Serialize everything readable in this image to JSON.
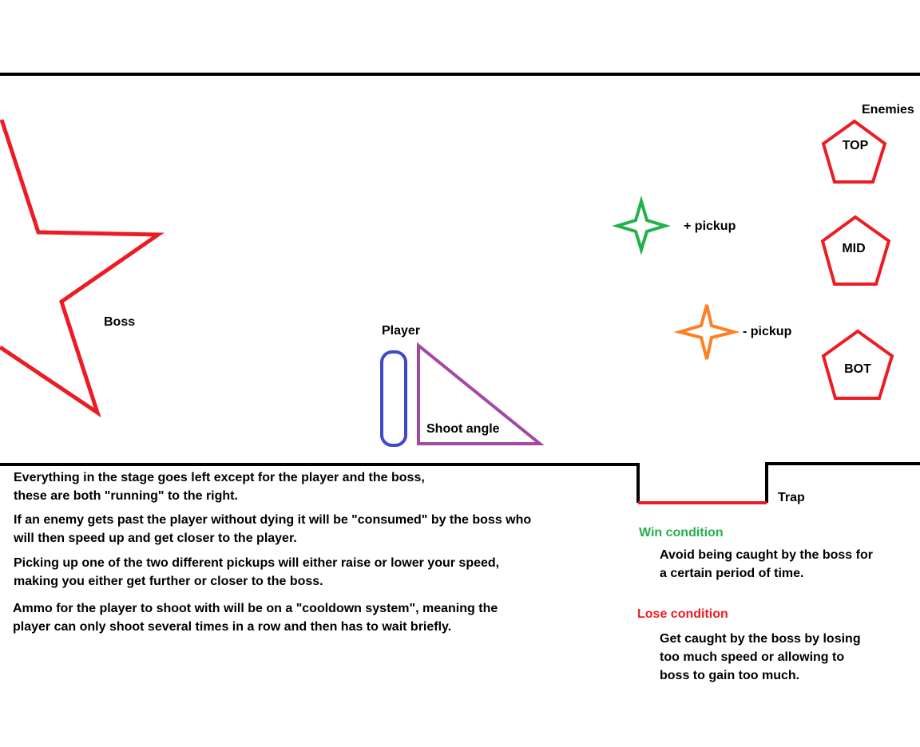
{
  "labels": {
    "enemies": "Enemies",
    "top": "TOP",
    "mid": "MID",
    "bot": "BOT",
    "plus_pickup": "+ pickup",
    "minus_pickup": "- pickup",
    "boss": "Boss",
    "player": "Player",
    "shoot_angle": "Shoot angle",
    "trap": "Trap"
  },
  "description": {
    "p1_line1": "Everything in the stage goes left except for the player and the boss,",
    "p1_line2": "these are both \"running\" to the right.",
    "p2_line1": "If an enemy gets past the player without dying it will be \"consumed\" by the boss who",
    "p2_line2": "will then speed up and get closer to the player.",
    "p3_line1": "Picking up one of the two different pickups will either raise or lower your speed,",
    "p3_line2": "making you either get further or closer to the boss.",
    "p4_line1": "Ammo for the player to shoot with will be on a \"cooldown system\", meaning the",
    "p4_line2": "player can only shoot several times in a row and then has to wait briefly."
  },
  "conditions": {
    "win_title": "Win condition",
    "win_line1": "Avoid being caught by the boss for",
    "win_line2": "a certain period of time.",
    "lose_title": "Lose condition",
    "lose_line1": "Get caught by the boss by losing",
    "lose_line2": "too much speed or allowing to",
    "lose_line3": "boss to gain too much."
  },
  "colors": {
    "boss": "#ed1c24",
    "enemy": "#ed1c24",
    "trap": "#ed1c24",
    "player": "#3f48cc",
    "shoot_angle": "#a349a4",
    "plus_pickup": "#22b14c",
    "minus_pickup": "#ff7f27",
    "win_title": "#22b14c",
    "lose_title": "#ed1c24",
    "lines": "#000000"
  },
  "icons": {
    "boss": "star-shape",
    "enemy": "pentagon-shape",
    "pickup": "four-point-star-shape",
    "player": "rounded-rectangle-shape",
    "shoot_angle": "right-triangle-shape"
  }
}
